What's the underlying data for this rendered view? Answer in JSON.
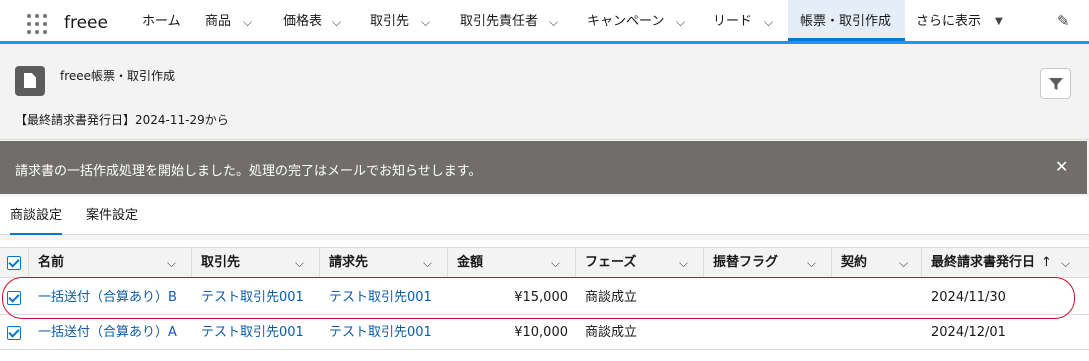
{
  "app": {
    "name": "freee"
  },
  "nav": {
    "items": [
      {
        "label": "ホーム"
      },
      {
        "label": "商品"
      },
      {
        "label": "価格表"
      },
      {
        "label": "取引先"
      },
      {
        "label": "取引先責任者"
      },
      {
        "label": "キャンペーン"
      },
      {
        "label": "リード"
      },
      {
        "label": "帳票・取引作成"
      },
      {
        "label": "さらに表示"
      }
    ]
  },
  "header": {
    "list_title": "freee帳票・取引作成",
    "filter_description": "【最終請求書発行日】2024-11-29から"
  },
  "toast": {
    "message": "請求書の一括作成処理を開始しました。処理の完了はメールでお知らせします。"
  },
  "tabs": [
    {
      "label": "商談設定"
    },
    {
      "label": "案件設定"
    }
  ],
  "table": {
    "columns": [
      "名前",
      "取引先",
      "請求先",
      "金額",
      "フェーズ",
      "振替フラグ",
      "契約",
      "最終請求書発行日"
    ],
    "sort_indicator": "↑",
    "rows": [
      {
        "name": "一括送付（合算あり）B",
        "account": "テスト取引先001",
        "billing": "テスト取引先001",
        "amount": "¥15,000",
        "phase": "商談成立",
        "transfer_flag": "",
        "contract": "",
        "last_invoice_date": "2024/11/30"
      },
      {
        "name": "一括送付（合算あり）A",
        "account": "テスト取引先001",
        "billing": "テスト取引先001",
        "amount": "¥10,000",
        "phase": "商談成立",
        "transfer_flag": "",
        "contract": "",
        "last_invoice_date": "2024/12/01"
      }
    ]
  },
  "colors": {
    "accent": "#0176d3",
    "link": "#0b5cab",
    "toast_bg": "#706e6b",
    "highlight": "#c8102e"
  }
}
